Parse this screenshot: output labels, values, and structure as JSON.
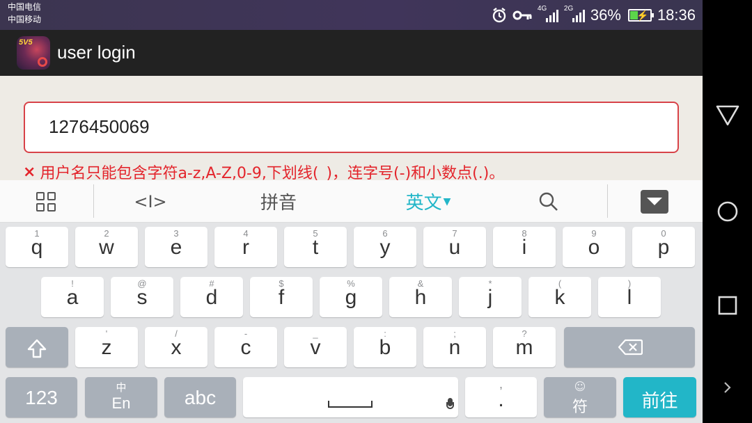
{
  "status_bar": {
    "carrier_1": "中国电信",
    "carrier_2": "中国移动",
    "network_1": "4G",
    "network_2": "2G",
    "battery": "36%",
    "battery_level": 0.36,
    "time": "18:36",
    "icons": [
      "alarm-icon",
      "vpn-key-icon",
      "signal-icon",
      "battery-charging-icon"
    ]
  },
  "app_bar": {
    "title": "user login",
    "icon_badge": "5V5"
  },
  "login_form": {
    "username_value": "1276450069",
    "error_icon": "×",
    "error_text": "用户名只能包含字符a-z,A-Z,0-9,下划线(_)，连字号(-)和小数点(.)。",
    "colors": {
      "error": "#e3242b",
      "border": "#d84248"
    }
  },
  "ime_toolbar": {
    "edit_cursor": "<I>",
    "pinyin": "拼音",
    "language": "英文",
    "icons": [
      "grid-menu-icon",
      "cursor-move-icon",
      "search-icon",
      "collapse-keyboard-icon"
    ],
    "accent": "#22b6c8"
  },
  "keyboard": {
    "row1": [
      {
        "hint": "1",
        "key": "q"
      },
      {
        "hint": "2",
        "key": "w"
      },
      {
        "hint": "3",
        "key": "e"
      },
      {
        "hint": "4",
        "key": "r"
      },
      {
        "hint": "5",
        "key": "t"
      },
      {
        "hint": "6",
        "key": "y"
      },
      {
        "hint": "7",
        "key": "u"
      },
      {
        "hint": "8",
        "key": "i"
      },
      {
        "hint": "9",
        "key": "o"
      },
      {
        "hint": "0",
        "key": "p"
      }
    ],
    "row2": [
      {
        "hint": "!",
        "key": "a"
      },
      {
        "hint": "@",
        "key": "s"
      },
      {
        "hint": "#",
        "key": "d"
      },
      {
        "hint": "$",
        "key": "f"
      },
      {
        "hint": "%",
        "key": "g"
      },
      {
        "hint": "&",
        "key": "h"
      },
      {
        "hint": "*",
        "key": "j"
      },
      {
        "hint": "(",
        "key": "k"
      },
      {
        "hint": ")",
        "key": "l"
      }
    ],
    "row3": [
      {
        "hint": "'",
        "key": "z"
      },
      {
        "hint": "/",
        "key": "x"
      },
      {
        "hint": "-",
        "key": "c"
      },
      {
        "hint": "_",
        "key": "v"
      },
      {
        "hint": ":",
        "key": "b"
      },
      {
        "hint": ";",
        "key": "n"
      },
      {
        "hint": "?",
        "key": "m"
      }
    ],
    "numbers_key": "123",
    "switch_top": "中",
    "switch_bottom": "En",
    "abc_key": "abc",
    "comma_hint": ",",
    "period_key": ".",
    "symbols_key": "符",
    "go_key": "前往"
  }
}
